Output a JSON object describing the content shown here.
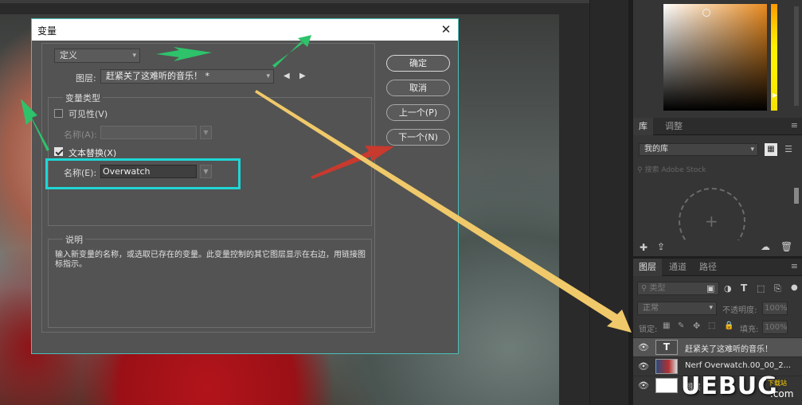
{
  "dialog": {
    "title": "变量",
    "close_glyph": "✕",
    "define_select": "定义",
    "layer_label": "图层:",
    "layer_value": "赶紧关了这难听的音乐！ *",
    "prev_arrow": "◀",
    "next_arrow": "▶",
    "variable_type_legend": "变量类型",
    "visibility_label": "可见性(V)",
    "visibility_checked": false,
    "name_a_label": "名称(A):",
    "name_a_value": "",
    "text_replace_label": "文本替换(X)",
    "text_replace_checked": true,
    "name_e_label": "名称(E):",
    "name_e_value": "Overwatch",
    "description_legend": "说明",
    "description_text": "输入新变量的名称，或选取已存在的变量。此变量控制的其它图层显示在右边，用链接图标指示。",
    "buttons": {
      "ok": "确定",
      "cancel": "取消",
      "prev": "上一个(P)",
      "next": "下一个(N)"
    }
  },
  "library_panel": {
    "tabs": [
      "库",
      "调整"
    ],
    "library_select": "我的库",
    "search_placeholder": "搜索 Adobe Stock"
  },
  "layers_panel": {
    "tabs": [
      "图层",
      "通道",
      "路径"
    ],
    "kind_filter": "类型",
    "blend_mode": "正常",
    "opacity_label": "不透明度:",
    "opacity_value": "100%",
    "lock_label": "锁定:",
    "fill_label": "填充:",
    "fill_value": "100%",
    "layers": [
      {
        "name": "赶紧关了这难听的音乐！",
        "type": "text",
        "selected": true
      },
      {
        "name": "Nerf Overwatch.00_00_2...",
        "type": "image",
        "selected": false
      },
      {
        "name": "图层",
        "type": "fill",
        "selected": false
      }
    ]
  },
  "watermark": {
    "text": "UEBUG",
    "sub": "下载站",
    "com": ".com"
  },
  "colors": {
    "dialog_bg": "#535353",
    "accent_highlight": "#1fd6d6",
    "arrow_green": "#2ec26b",
    "arrow_red": "#c8392e",
    "arrow_yellow": "#f0c96a"
  }
}
